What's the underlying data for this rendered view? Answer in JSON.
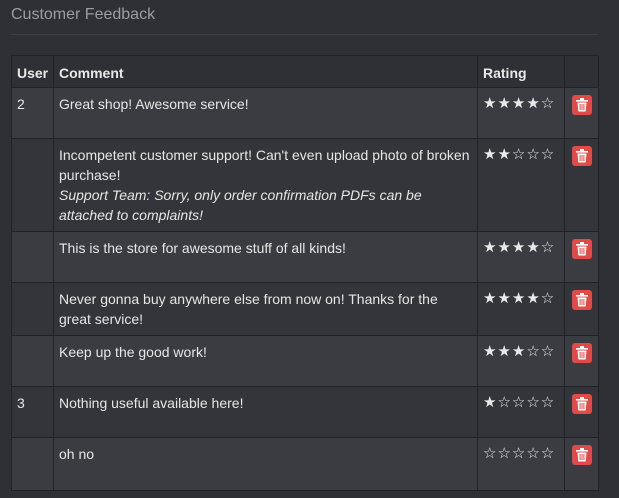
{
  "page_title": "Customer Feedback",
  "columns": {
    "user": "User",
    "comment": "Comment",
    "rating": "Rating"
  },
  "rows": [
    {
      "user": "2",
      "comment": "Great shop! Awesome service!",
      "reply": "",
      "stars": "★★★★☆",
      "rating": 4
    },
    {
      "user": "",
      "comment": "Incompetent customer support! Can't even upload photo of broken purchase!",
      "reply": "Support Team: Sorry, only order confirmation PDFs can be attached to complaints!",
      "stars": "★★☆☆☆",
      "rating": 2
    },
    {
      "user": "",
      "comment": "This is the store for awesome stuff of all kinds!",
      "reply": "",
      "stars": "★★★★☆",
      "rating": 4
    },
    {
      "user": "",
      "comment": "Never gonna buy anywhere else from now on! Thanks for the great service!",
      "reply": "",
      "stars": "★★★★☆",
      "rating": 4
    },
    {
      "user": "",
      "comment": "Keep up the good work!",
      "reply": "",
      "stars": "★★★☆☆",
      "rating": 3
    },
    {
      "user": "3",
      "comment": "Nothing useful available here!",
      "reply": "",
      "stars": "★☆☆☆☆",
      "rating": 1
    },
    {
      "user": "",
      "comment": "oh no",
      "reply": "",
      "stars": "☆☆☆☆☆",
      "rating": 0
    }
  ],
  "icons": {
    "delete": "trash-icon"
  },
  "colors": {
    "delete_button": "#e04a4a",
    "background": "#2e3035"
  }
}
